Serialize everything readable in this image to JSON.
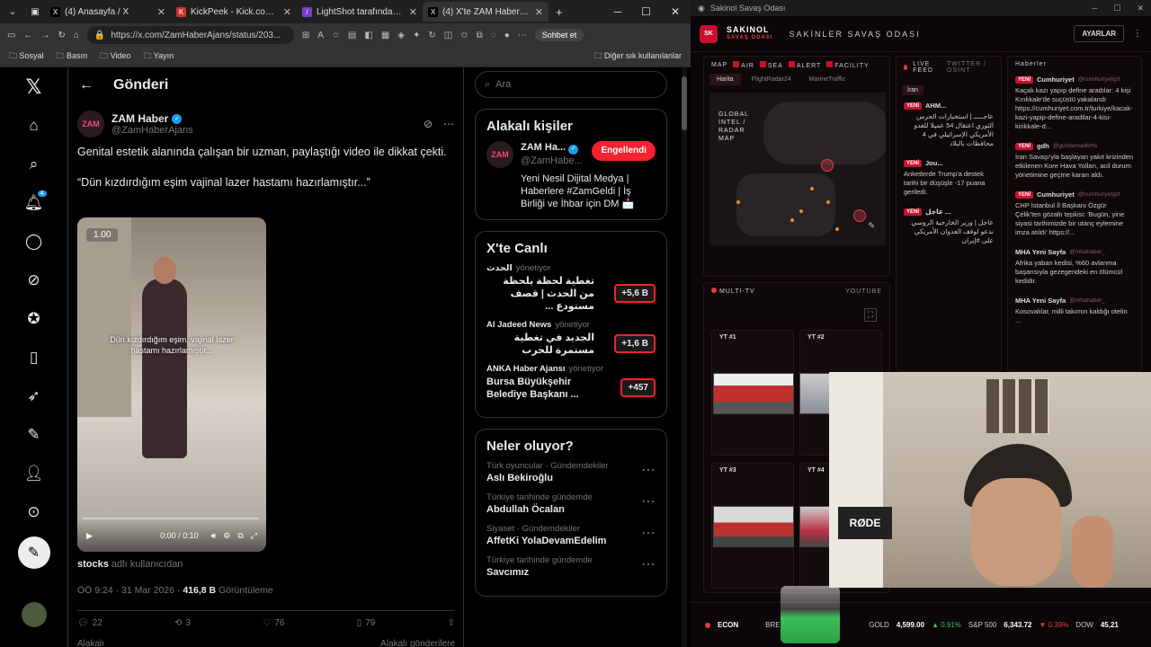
{
  "browser": {
    "tabs": [
      {
        "label": "(4) Anasayfa / X",
        "icon": "X"
      },
      {
        "label": "KickPeek - Kick.com için Gerç",
        "icon": "K"
      },
      {
        "label": "LightShot tarafından Ekran Gö",
        "icon": "/"
      },
      {
        "label": "(4) X'te ZAM Haber: \"Genital",
        "icon": "X"
      }
    ],
    "url": "https://x.com/ZamHaberAjans/status/203...",
    "chat_label": "Sohbet et",
    "bookmarks": [
      "Sosyal",
      "Basın",
      "Video",
      "Yayın"
    ],
    "bookmarks_more": "Diğer sık kullanılanlar"
  },
  "nav": {
    "notification_count": "4"
  },
  "post": {
    "header": "Gönderi",
    "author": "ZAM Haber",
    "handle": "@ZamHaberAjans",
    "avatar_text": "ZAM",
    "text1": "Genital estetik alanında çalışan bir uzman, paylaştığı video ile dikkat çekti.",
    "text2": "“Dün kızdırdığım eşim vajinal lazer hastamı hazırlamıştır...”",
    "video": {
      "speed": "1.00",
      "caption": "Dün kızdırdığım eşim, vajinal lazer hastamı hazırlamıştır...",
      "time": "0:00 / 0:10"
    },
    "user_label": "stocks",
    "user_label_suffix": "adlı kullanıcıdan",
    "timestamp": "ÖÖ 9:24 · 31 Mar 2026 · ",
    "views": "416,8 B",
    "views_label": "Görüntüleme",
    "replies": "22",
    "reposts": "3",
    "likes": "76",
    "bookmarks": "79",
    "foot_left": "Alakalı",
    "foot_right": "Alakalı gönderilere"
  },
  "sidebar": {
    "search_placeholder": "Ara",
    "related_title": "Alakalı kişiler",
    "related": {
      "name": "ZAM Ha...",
      "handle": "@ZamHabe...",
      "button": "Engellendi",
      "bio": "Yeni Nesil Dijital Medya | Haberlere #ZamGeldi | İş Birliği ve İhbar için DM 📩"
    },
    "live_title": "X'te Canlı",
    "live": [
      {
        "who": "الحدث",
        "role": "yönetiyor",
        "title": "تغطية لحظة بلحظة من الحدث | قصف مستودع ...",
        "count": "+5,6 B"
      },
      {
        "who": "Al Jadeed News",
        "role": "yönetiyor",
        "title": "الجديد في تغطية مستمرة للحرب",
        "count": "+1,6 B"
      },
      {
        "who": "ANKA Haber Ajansı",
        "role": "yönetiyor",
        "title": "Bursa Büyükşehir Belediye Başkanı ...",
        "count": "+457"
      }
    ],
    "trends_title": "Neler oluyor?",
    "trends": [
      {
        "cat": "Türk oyuncular · Gündemdekiler",
        "name": "Aslı Bekiroğlu"
      },
      {
        "cat": "Türkiye tarihinde gündemde",
        "name": "Abdullah Öcalan"
      },
      {
        "cat": "Siyaset · Gündemdekiler",
        "name": "AffetKi YolaDevamEdelim"
      },
      {
        "cat": "Türkiye tarihinde gündemde",
        "name": "Savcımız"
      }
    ]
  },
  "app": {
    "window_title": "Sakinol Savaş Odası",
    "brand": "SAKINOL",
    "brand_sub": "SAVAŞ ODASI",
    "title": "SAKİNLER SAVAŞ ODASI",
    "settings": "AYARLAR",
    "map_header": "MAP",
    "map_layers": [
      "AIR",
      "SEA",
      "ALERT",
      "FACILITY"
    ],
    "map_tabs": [
      "Harita",
      "FlightRadar24",
      "MarineTraffic"
    ],
    "map_label": "GLOBAL INTEL / RADAR MAP",
    "live_feed": "LIVE FEED",
    "live_feed_tabs": "TWITTER / OSINT",
    "live_feed_filter": "İran",
    "feed_items": [
      {
        "src": "AHM...",
        "tag": "YENİ",
        "text": "عاجـــــ | استخبارات الحرس الثوري اعتقال 54 عميلا للعدو الأمريكي الإسرائيلي في 4 محافظات بالبلاد"
      },
      {
        "src": "Jou...",
        "tag": "YENİ",
        "text": "Anketlerde Trump'a destek tarihi bir düşüşle -17 puana geriledi."
      },
      {
        "src": "عاجل ...",
        "tag": "YENİ",
        "text": "عاجل | وزير الخارجية الروسي: ندعو لوقف العدوان الأمريكي على #إيران"
      }
    ],
    "news_header": "Haberler",
    "news": [
      {
        "src": "Cumhuriyet",
        "handle": "@cumhuriyetgzt",
        "tag": "YENİ",
        "text": "Kaçak kazı yapıp define aradılar: 4 kişi Kırıkkale'de suçüstü yakalandı https://cumhuriyet.com.tr/turkiye/kacak-kazi-yapip-define-aradilar-4-kisi-kirikkale-d..."
      },
      {
        "src": "gdh",
        "handle": "@gundemadkrhs",
        "tag": "YENİ",
        "text": "İran Savaşı'yla başlayan yakıt krizinden etkilenen Kore Hava Yolları, acil durum yönetimine geçme kararı aldı."
      },
      {
        "src": "Cumhuriyet",
        "handle": "@cumhuriyetgzt",
        "tag": "YENİ",
        "text": "CHP İstanbul İl Başkanı Özgür Çelik'ten gözaltı tepkisi: 'Bugün, yine siyasi tarihimizde bir utanç eylemine imza atıldı' https://..."
      },
      {
        "src": "MHA Yeni Sayfa",
        "handle": "@mhahaber_",
        "tag": "",
        "text": "Afrika yaban kedisi, %60 avlanma başarısıyla gezegendeki en ölümcül kedidir."
      },
      {
        "src": "MHA Yeni Sayfa",
        "handle": "@mhahaber_",
        "tag": "",
        "text": "Kosovalılar, milli takımın kaldığı otelin ..."
      }
    ],
    "multitv": "MULTI-TV",
    "youtube": "YOUTUBE",
    "tv": [
      "YT #1",
      "YT #2",
      "YT #3",
      "YT #4"
    ],
    "ticker": [
      {
        "label": "ECON",
        "value": "",
        "change": ""
      },
      {
        "label": "BRENT",
        "value": "",
        "change": ""
      },
      {
        "label": "GOLD",
        "value": "4,599.00",
        "change": "▲ 0.91%"
      },
      {
        "label": "S&P 500",
        "value": "6,343.72",
        "change": "▼ 0.39%"
      },
      {
        "label": "DOW",
        "value": "45,21",
        "change": ""
      }
    ],
    "cam_mic": "RØDE"
  }
}
